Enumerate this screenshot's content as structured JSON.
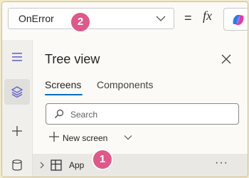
{
  "formula_bar": {
    "property_value": "OnError",
    "equals": "=",
    "fx_label": "fx"
  },
  "tree_view": {
    "title": "Tree view",
    "tabs": [
      {
        "label": "Screens",
        "active": true
      },
      {
        "label": "Components",
        "active": false
      }
    ],
    "search_placeholder": "Search",
    "new_screen_label": "New screen",
    "nodes": [
      {
        "label": "App",
        "more_label": "···"
      }
    ]
  },
  "annotations": [
    {
      "number": "1"
    },
    {
      "number": "2"
    }
  ],
  "colors": {
    "accent": "#0f6cbd",
    "badge": "#e0588a",
    "border_highlight": "#f1e8c6"
  },
  "icons": {
    "rail": [
      "hamburger-icon",
      "layers-icon",
      "plus-icon",
      "database-icon"
    ],
    "pane": [
      "close-icon",
      "search-icon",
      "plus-icon",
      "chevron-down-icon",
      "chevron-right-icon",
      "app-icon"
    ],
    "formula": [
      "chevron-down-icon",
      "fx-icon",
      "copilot-icon"
    ]
  }
}
